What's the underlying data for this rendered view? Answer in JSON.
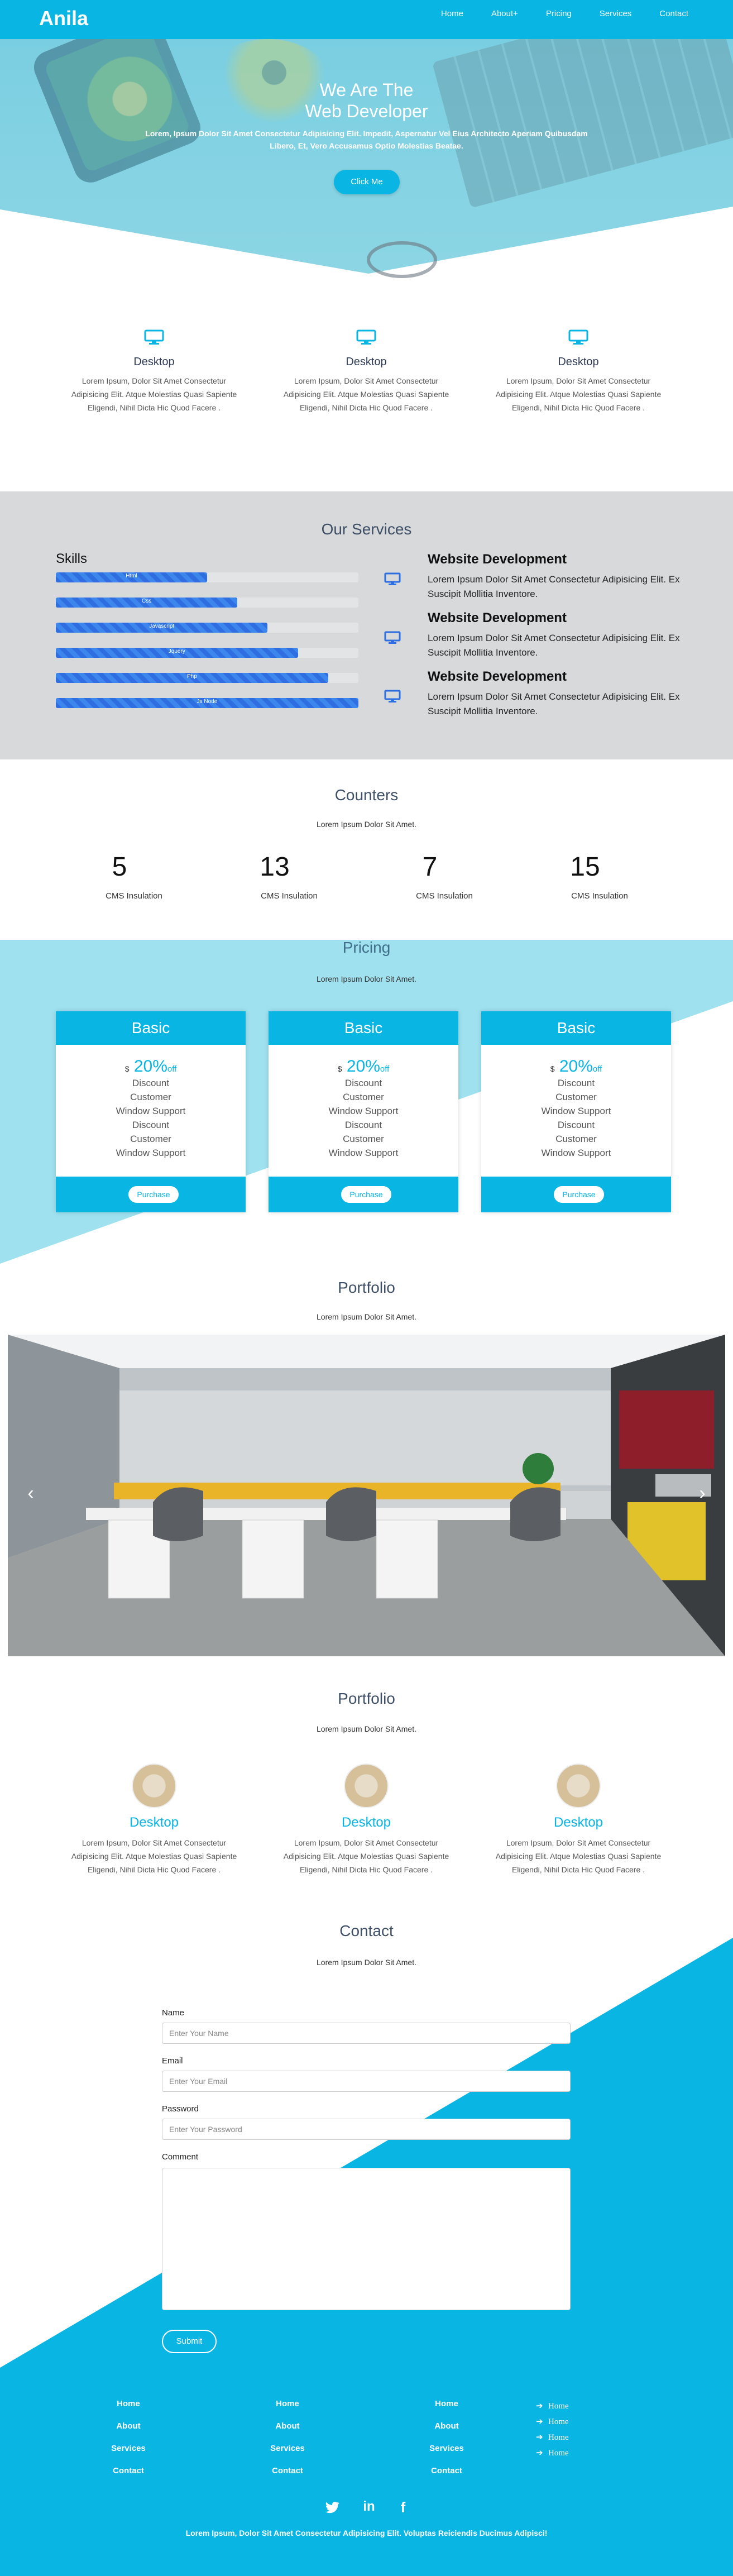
{
  "nav": {
    "brand": "Anila",
    "links": [
      "Home",
      "About+",
      "Pricing",
      "Services",
      "Contact"
    ]
  },
  "hero": {
    "title_line1": "We Are The",
    "title_line2": "Web Developer",
    "subtitle": "Lorem, Ipsum Dolor Sit Amet Consectetur Adipisicing Elit. Impedit, Aspernatur Vel Eius Architecto Aperiam Quibusdam Libero, Et, Vero Accusamus Optio Molestias Beatae.",
    "button": "Click Me"
  },
  "features": [
    {
      "icon": "desktop-icon",
      "title": "Desktop",
      "text": "Lorem Ipsum, Dolor Sit Amet Consectetur Adipisicing Elit. Atque Molestias Quasi Sapiente Eligendi, Nihil Dicta Hic Quod Facere ."
    },
    {
      "icon": "desktop-icon",
      "title": "Desktop",
      "text": "Lorem Ipsum, Dolor Sit Amet Consectetur Adipisicing Elit. Atque Molestias Quasi Sapiente Eligendi, Nihil Dicta Hic Quod Facere ."
    },
    {
      "icon": "desktop-icon",
      "title": "Desktop",
      "text": "Lorem Ipsum, Dolor Sit Amet Consectetur Adipisicing Elit. Atque Molestias Quasi Sapiente Eligendi, Nihil Dicta Hic Quod Facere ."
    }
  ],
  "services": {
    "title": "Our Services",
    "skills_heading": "Skills",
    "skills": [
      {
        "label": "Html",
        "percent": 50
      },
      {
        "label": "Css",
        "percent": 60
      },
      {
        "label": "Javascript",
        "percent": 70
      },
      {
        "label": "Jquery",
        "percent": 80
      },
      {
        "label": "Php",
        "percent": 90
      },
      {
        "label": "Js Node",
        "percent": 100
      }
    ],
    "items": [
      {
        "icon": "monitor-icon",
        "title": "Website Development",
        "text": "Lorem Ipsum Dolor Sit Amet Consectetur Adipisicing Elit. Ex Suscipit Mollitia Inventore."
      },
      {
        "icon": "monitor-icon",
        "title": "Website Development",
        "text": "Lorem Ipsum Dolor Sit Amet Consectetur Adipisicing Elit. Ex Suscipit Mollitia Inventore."
      },
      {
        "icon": "monitor-icon",
        "title": "Website Development",
        "text": "Lorem Ipsum Dolor Sit Amet Consectetur Adipisicing Elit. Ex Suscipit Mollitia Inventore."
      }
    ]
  },
  "counters": {
    "title": "Counters",
    "subtitle": "Lorem Ipsum Dolor Sit Amet.",
    "items": [
      {
        "value": "5",
        "label": "CMS Insulation"
      },
      {
        "value": "13",
        "label": "CMS Insulation"
      },
      {
        "value": "7",
        "label": "CMS Insulation"
      },
      {
        "value": "15",
        "label": "CMS Insulation"
      }
    ]
  },
  "pricing": {
    "title": "Pricing",
    "subtitle": "Lorem Ipsum Dolor Sit Amet.",
    "plans": [
      {
        "name": "Basic",
        "currency": "$",
        "amount": "20%",
        "unit": "off",
        "features": [
          "Discount",
          "Customer",
          "Window Support",
          "Discount",
          "Customer",
          "Window Support"
        ],
        "button": "Purchase"
      },
      {
        "name": "Basic",
        "currency": "$",
        "amount": "20%",
        "unit": "off",
        "features": [
          "Discount",
          "Customer",
          "Window Support",
          "Discount",
          "Customer",
          "Window Support"
        ],
        "button": "Purchase"
      },
      {
        "name": "Basic",
        "currency": "$",
        "amount": "20%",
        "unit": "off",
        "features": [
          "Discount",
          "Customer",
          "Window Support",
          "Discount",
          "Customer",
          "Window Support"
        ],
        "button": "Purchase"
      }
    ]
  },
  "portfolio": {
    "title": "Portfolio",
    "subtitle": "Lorem Ipsum Dolor Sit Amet.",
    "prev": "‹",
    "next": "›"
  },
  "portfolio2": {
    "title": "Portfolio",
    "subtitle": "Lorem Ipsum Dolor Sit Amet.",
    "items": [
      {
        "title": "Desktop",
        "text": "Lorem Ipsum, Dolor Sit Amet Consectetur Adipisicing Elit. Atque Molestias Quasi Sapiente Eligendi, Nihil Dicta Hic Quod Facere ."
      },
      {
        "title": "Desktop",
        "text": "Lorem Ipsum, Dolor Sit Amet Consectetur Adipisicing Elit. Atque Molestias Quasi Sapiente Eligendi, Nihil Dicta Hic Quod Facere ."
      },
      {
        "title": "Desktop",
        "text": "Lorem Ipsum, Dolor Sit Amet Consectetur Adipisicing Elit. Atque Molestias Quasi Sapiente Eligendi, Nihil Dicta Hic Quod Facere ."
      }
    ]
  },
  "contact": {
    "title": "Contact",
    "subtitle": "Lorem Ipsum Dolor Sit Amet.",
    "name_label": "Name",
    "name_placeholder": "Enter Your Name",
    "email_label": "Email",
    "email_placeholder": "Enter Your Email",
    "password_label": "Password",
    "password_placeholder": "Enter Your Password",
    "comment_label": "Comment",
    "submit": "Submit"
  },
  "footer": {
    "columns": [
      [
        "Home",
        "About",
        "Services",
        "Contact"
      ],
      [
        "Home",
        "About",
        "Services",
        "Contact"
      ],
      [
        "Home",
        "About",
        "Services",
        "Contact"
      ]
    ],
    "list_items": [
      "Home",
      "Home",
      "Home",
      "Home"
    ],
    "social": [
      {
        "icon": "twitter-icon",
        "glyph": "𝕥"
      },
      {
        "icon": "linkedin-icon",
        "glyph": "in"
      },
      {
        "icon": "facebook-icon",
        "glyph": "f"
      }
    ],
    "text": "Lorem Ipsum, Dolor Sit Amet Consectetur Adipisicing Elit. Voluptas Reiciendis Ducimus Adipisci!"
  },
  "colors": {
    "accent": "#09b5e2",
    "services_bg": "#d7d9da",
    "skill_bar": "#2e6ee0"
  }
}
